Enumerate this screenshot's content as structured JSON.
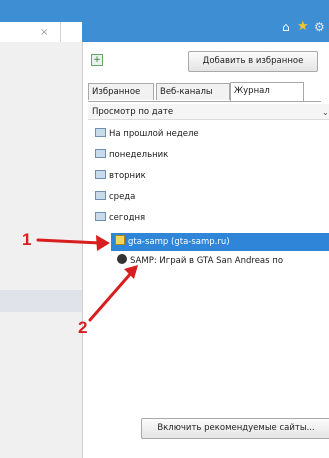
{
  "left_tab": {
    "close_glyph": "×"
  },
  "toolbar": {
    "home_icon": "home-icon",
    "star_icon": "star-icon",
    "gear_icon": "gear-icon"
  },
  "favorites_panel": {
    "add_button_label": "Добавить в избранное",
    "tabs": [
      {
        "label": "Избранное",
        "active": false
      },
      {
        "label": "Веб-каналы",
        "active": false
      },
      {
        "label": "Журнал",
        "active": true
      }
    ],
    "sort_label": "Просмотр по дате",
    "history_groups": [
      {
        "label": "На прошлой неделе"
      },
      {
        "label": "понедельник"
      },
      {
        "label": "вторник"
      },
      {
        "label": "среда"
      },
      {
        "label": "сегодня"
      }
    ],
    "selected_site": "gta-samp (gta-samp.ru)",
    "page_entry": "SAMP: Играй в GTA San Andreas по",
    "bottom_button_label": "Включить рекомендуемые сайты..."
  },
  "annotations": [
    {
      "label": "1"
    },
    {
      "label": "2"
    }
  ],
  "colors": {
    "accent": "#3e8ed4",
    "selection": "#2f86d8",
    "annotation": "#d81e1e"
  }
}
